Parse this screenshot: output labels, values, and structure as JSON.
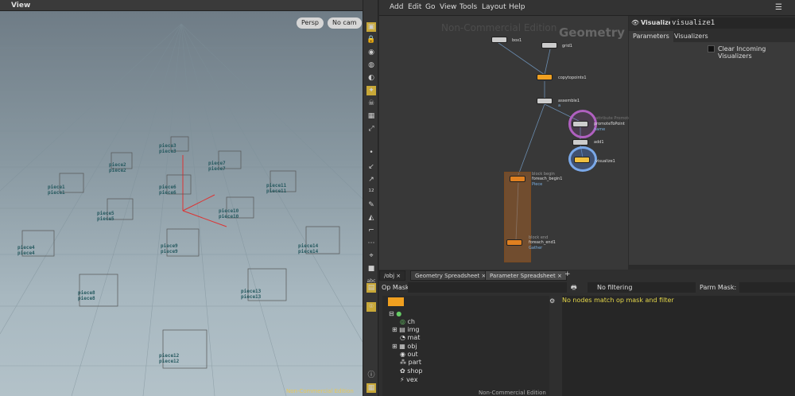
{
  "viewport": {
    "title": "View",
    "persp": "Persp",
    "cam": "No cam",
    "watermark": "Non-Commercial Edition",
    "pieces": [
      [
        "piece3",
        "piece3"
      ],
      [
        "piece2",
        "piece2"
      ],
      [
        "piece7",
        "piece7"
      ],
      [
        "piece1",
        "piece1"
      ],
      [
        "piece6",
        "piece6"
      ],
      [
        "piece11",
        "piece11"
      ],
      [
        "piece5",
        "piece5"
      ],
      [
        "piece10",
        "piece10"
      ],
      [
        "piece4",
        "piece4"
      ],
      [
        "piece9",
        "piece9"
      ],
      [
        "piece14",
        "piece14"
      ],
      [
        "piece8",
        "piece8"
      ],
      [
        "piece13",
        "piece13"
      ],
      [
        "piece12",
        "piece12"
      ]
    ]
  },
  "menu": [
    "Add",
    "Edit",
    "Go",
    "View",
    "Tools",
    "Layout",
    "Help"
  ],
  "network": {
    "watermark": "Non-Commercial Edition",
    "context": "Geometry",
    "nodes": {
      "box1": "box1",
      "grid1": "grid1",
      "copy": "copytopoints1",
      "assemble": "assemble1",
      "assemble_sub": "a",
      "attrpromote": "attribute Promote",
      "promote": "promoteToPoint",
      "promote_sub": "name",
      "add": "add1",
      "visualize": "visualize1",
      "block_begin": "block begin",
      "foreach_begin": "foreach_begin1",
      "piece": "Piece",
      "block_end": "block end",
      "foreach_end": "foreach_end1",
      "gather": "Gather"
    }
  },
  "params": {
    "node_type": "Visualize",
    "node_name": "visualize1",
    "tabs": [
      "Parameters",
      "Visualizers"
    ],
    "clear_label": "Clear Incoming Visualizers"
  },
  "sheet": {
    "tabs": [
      "/obj",
      "Geometry Spreadsheet",
      "Parameter Spreadsheet"
    ],
    "op_mask": "Op Mask:",
    "filter": "No filtering",
    "parm_mask": "Parm Mask:",
    "message": "No nodes match op mask and filter",
    "watermark": "Non-Commercial Edition",
    "tree": [
      "ch",
      "img",
      "mat",
      "obj",
      "out",
      "part",
      "shop",
      "vex"
    ]
  }
}
